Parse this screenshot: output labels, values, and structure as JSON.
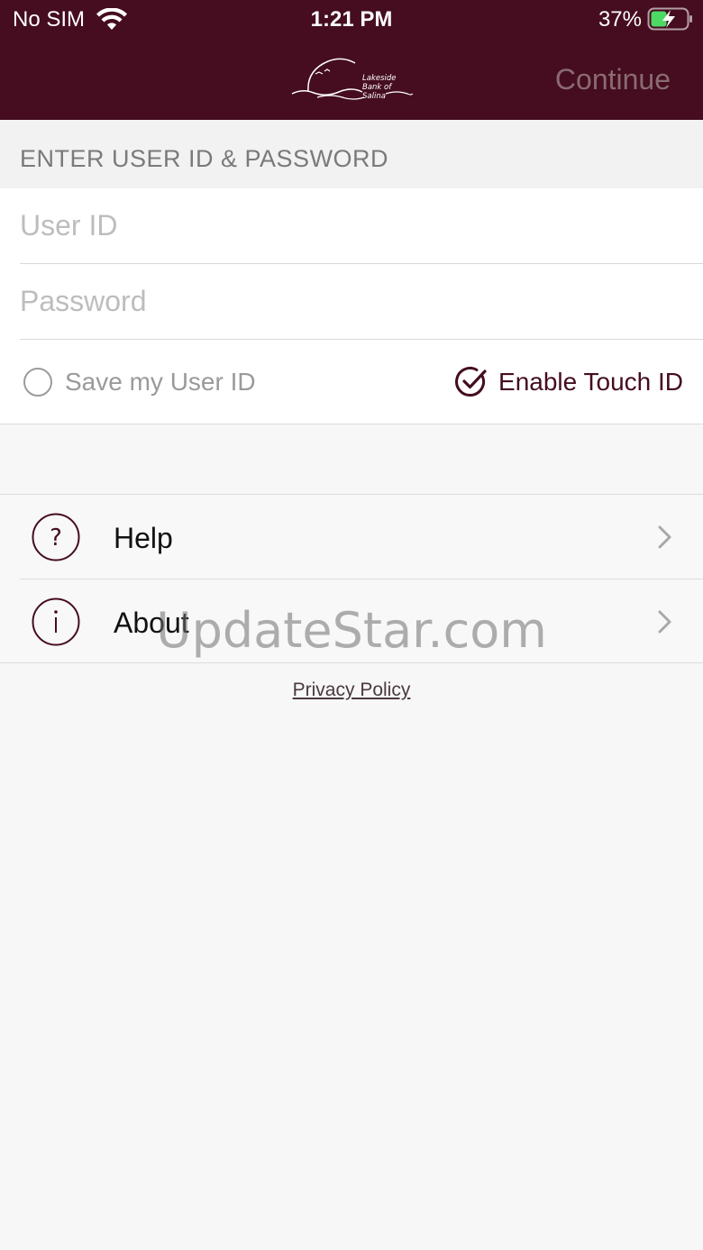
{
  "status_bar": {
    "carrier": "No SIM",
    "time": "1:21 PM",
    "battery": "37%"
  },
  "header": {
    "logo_text": [
      "Lakeside",
      "Bank of",
      "Salina"
    ],
    "continue_label": "Continue",
    "background_color": "#450d1f"
  },
  "section": {
    "title": "ENTER USER ID & PASSWORD"
  },
  "form": {
    "user_id_placeholder": "User ID",
    "password_placeholder": "Password",
    "save_user_id_label": "Save my User ID",
    "save_user_id_checked": false,
    "touch_id_label": "Enable Touch ID",
    "touch_id_checked": true
  },
  "menu": {
    "items": [
      {
        "label": "Help",
        "icon": "question-circle-icon"
      },
      {
        "label": "About",
        "icon": "info-circle-icon"
      }
    ]
  },
  "footer": {
    "privacy_label": "Privacy Policy"
  },
  "watermark": "UpdateStar.com",
  "colors": {
    "accent": "#450d1f",
    "background": "#f7f7f7"
  }
}
